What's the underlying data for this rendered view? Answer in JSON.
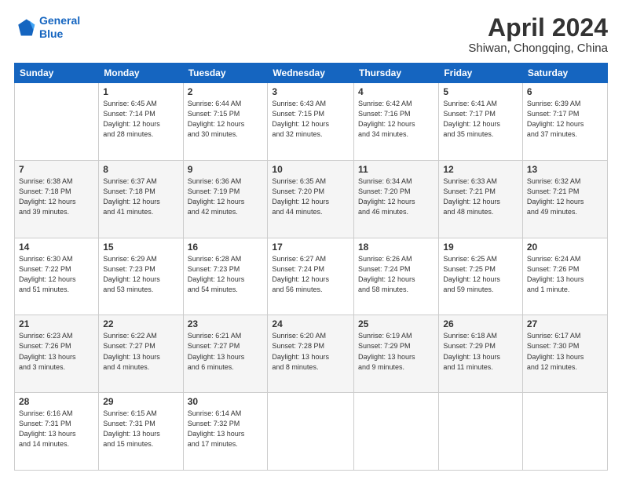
{
  "logo": {
    "line1": "General",
    "line2": "Blue"
  },
  "title": "April 2024",
  "subtitle": "Shiwan, Chongqing, China",
  "days": [
    "Sunday",
    "Monday",
    "Tuesday",
    "Wednesday",
    "Thursday",
    "Friday",
    "Saturday"
  ],
  "weeks": [
    [
      {
        "day": "",
        "content": ""
      },
      {
        "day": "1",
        "content": "Sunrise: 6:45 AM\nSunset: 7:14 PM\nDaylight: 12 hours\nand 28 minutes."
      },
      {
        "day": "2",
        "content": "Sunrise: 6:44 AM\nSunset: 7:15 PM\nDaylight: 12 hours\nand 30 minutes."
      },
      {
        "day": "3",
        "content": "Sunrise: 6:43 AM\nSunset: 7:15 PM\nDaylight: 12 hours\nand 32 minutes."
      },
      {
        "day": "4",
        "content": "Sunrise: 6:42 AM\nSunset: 7:16 PM\nDaylight: 12 hours\nand 34 minutes."
      },
      {
        "day": "5",
        "content": "Sunrise: 6:41 AM\nSunset: 7:17 PM\nDaylight: 12 hours\nand 35 minutes."
      },
      {
        "day": "6",
        "content": "Sunrise: 6:39 AM\nSunset: 7:17 PM\nDaylight: 12 hours\nand 37 minutes."
      }
    ],
    [
      {
        "day": "7",
        "content": "Sunrise: 6:38 AM\nSunset: 7:18 PM\nDaylight: 12 hours\nand 39 minutes."
      },
      {
        "day": "8",
        "content": "Sunrise: 6:37 AM\nSunset: 7:18 PM\nDaylight: 12 hours\nand 41 minutes."
      },
      {
        "day": "9",
        "content": "Sunrise: 6:36 AM\nSunset: 7:19 PM\nDaylight: 12 hours\nand 42 minutes."
      },
      {
        "day": "10",
        "content": "Sunrise: 6:35 AM\nSunset: 7:20 PM\nDaylight: 12 hours\nand 44 minutes."
      },
      {
        "day": "11",
        "content": "Sunrise: 6:34 AM\nSunset: 7:20 PM\nDaylight: 12 hours\nand 46 minutes."
      },
      {
        "day": "12",
        "content": "Sunrise: 6:33 AM\nSunset: 7:21 PM\nDaylight: 12 hours\nand 48 minutes."
      },
      {
        "day": "13",
        "content": "Sunrise: 6:32 AM\nSunset: 7:21 PM\nDaylight: 12 hours\nand 49 minutes."
      }
    ],
    [
      {
        "day": "14",
        "content": "Sunrise: 6:30 AM\nSunset: 7:22 PM\nDaylight: 12 hours\nand 51 minutes."
      },
      {
        "day": "15",
        "content": "Sunrise: 6:29 AM\nSunset: 7:23 PM\nDaylight: 12 hours\nand 53 minutes."
      },
      {
        "day": "16",
        "content": "Sunrise: 6:28 AM\nSunset: 7:23 PM\nDaylight: 12 hours\nand 54 minutes."
      },
      {
        "day": "17",
        "content": "Sunrise: 6:27 AM\nSunset: 7:24 PM\nDaylight: 12 hours\nand 56 minutes."
      },
      {
        "day": "18",
        "content": "Sunrise: 6:26 AM\nSunset: 7:24 PM\nDaylight: 12 hours\nand 58 minutes."
      },
      {
        "day": "19",
        "content": "Sunrise: 6:25 AM\nSunset: 7:25 PM\nDaylight: 12 hours\nand 59 minutes."
      },
      {
        "day": "20",
        "content": "Sunrise: 6:24 AM\nSunset: 7:26 PM\nDaylight: 13 hours\nand 1 minute."
      }
    ],
    [
      {
        "day": "21",
        "content": "Sunrise: 6:23 AM\nSunset: 7:26 PM\nDaylight: 13 hours\nand 3 minutes."
      },
      {
        "day": "22",
        "content": "Sunrise: 6:22 AM\nSunset: 7:27 PM\nDaylight: 13 hours\nand 4 minutes."
      },
      {
        "day": "23",
        "content": "Sunrise: 6:21 AM\nSunset: 7:27 PM\nDaylight: 13 hours\nand 6 minutes."
      },
      {
        "day": "24",
        "content": "Sunrise: 6:20 AM\nSunset: 7:28 PM\nDaylight: 13 hours\nand 8 minutes."
      },
      {
        "day": "25",
        "content": "Sunrise: 6:19 AM\nSunset: 7:29 PM\nDaylight: 13 hours\nand 9 minutes."
      },
      {
        "day": "26",
        "content": "Sunrise: 6:18 AM\nSunset: 7:29 PM\nDaylight: 13 hours\nand 11 minutes."
      },
      {
        "day": "27",
        "content": "Sunrise: 6:17 AM\nSunset: 7:30 PM\nDaylight: 13 hours\nand 12 minutes."
      }
    ],
    [
      {
        "day": "28",
        "content": "Sunrise: 6:16 AM\nSunset: 7:31 PM\nDaylight: 13 hours\nand 14 minutes."
      },
      {
        "day": "29",
        "content": "Sunrise: 6:15 AM\nSunset: 7:31 PM\nDaylight: 13 hours\nand 15 minutes."
      },
      {
        "day": "30",
        "content": "Sunrise: 6:14 AM\nSunset: 7:32 PM\nDaylight: 13 hours\nand 17 minutes."
      },
      {
        "day": "",
        "content": ""
      },
      {
        "day": "",
        "content": ""
      },
      {
        "day": "",
        "content": ""
      },
      {
        "day": "",
        "content": ""
      }
    ]
  ]
}
